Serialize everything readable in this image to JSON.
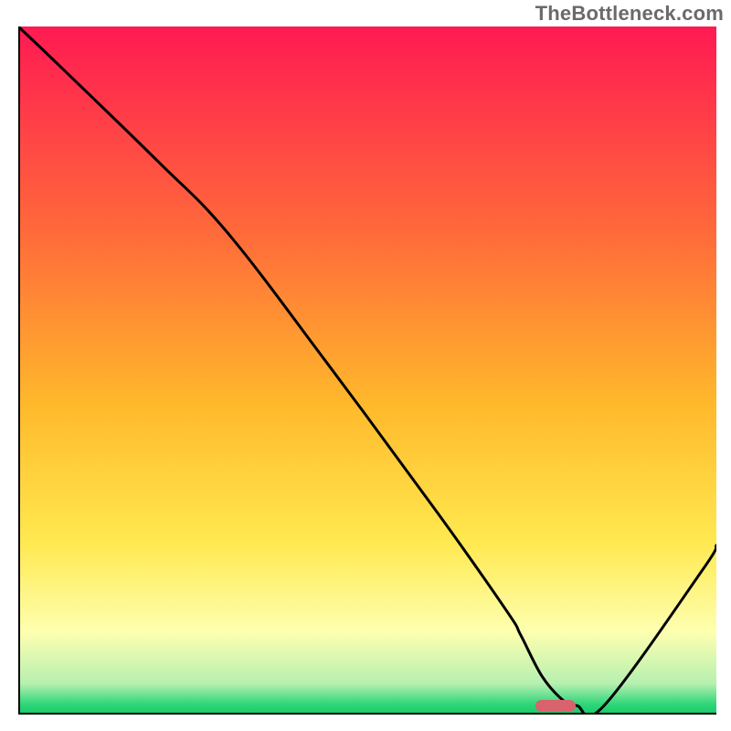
{
  "watermark": "TheBottleneck.com",
  "chart_data": {
    "type": "line",
    "title": "",
    "xlabel": "",
    "ylabel": "",
    "xlim": [
      0,
      100
    ],
    "ylim": [
      0,
      100
    ],
    "gradient_background": {
      "description": "vertical gradient red→orange→yellow→light-green→green with thin green band at bottom",
      "stops": [
        {
          "pos": 0.0,
          "color": "#ff1a52"
        },
        {
          "pos": 0.3,
          "color": "#ff6a3a"
        },
        {
          "pos": 0.55,
          "color": "#ffb92b"
        },
        {
          "pos": 0.75,
          "color": "#ffe950"
        },
        {
          "pos": 0.88,
          "color": "#feffb0"
        },
        {
          "pos": 0.955,
          "color": "#b6f0b0"
        },
        {
          "pos": 0.985,
          "color": "#2fd67a"
        },
        {
          "pos": 1.0,
          "color": "#17c96a"
        }
      ]
    },
    "x": [
      0,
      6,
      20,
      30,
      44,
      60,
      70,
      72,
      75,
      78,
      80,
      84,
      98,
      100
    ],
    "values": [
      100,
      94.2,
      80.4,
      70,
      51.4,
      29.4,
      15,
      11.5,
      5.6,
      2.1,
      1.3,
      1.4,
      21,
      24.6
    ],
    "optimal_marker": {
      "x_center": 77,
      "y": 1.3,
      "color": "#d9626e"
    }
  }
}
